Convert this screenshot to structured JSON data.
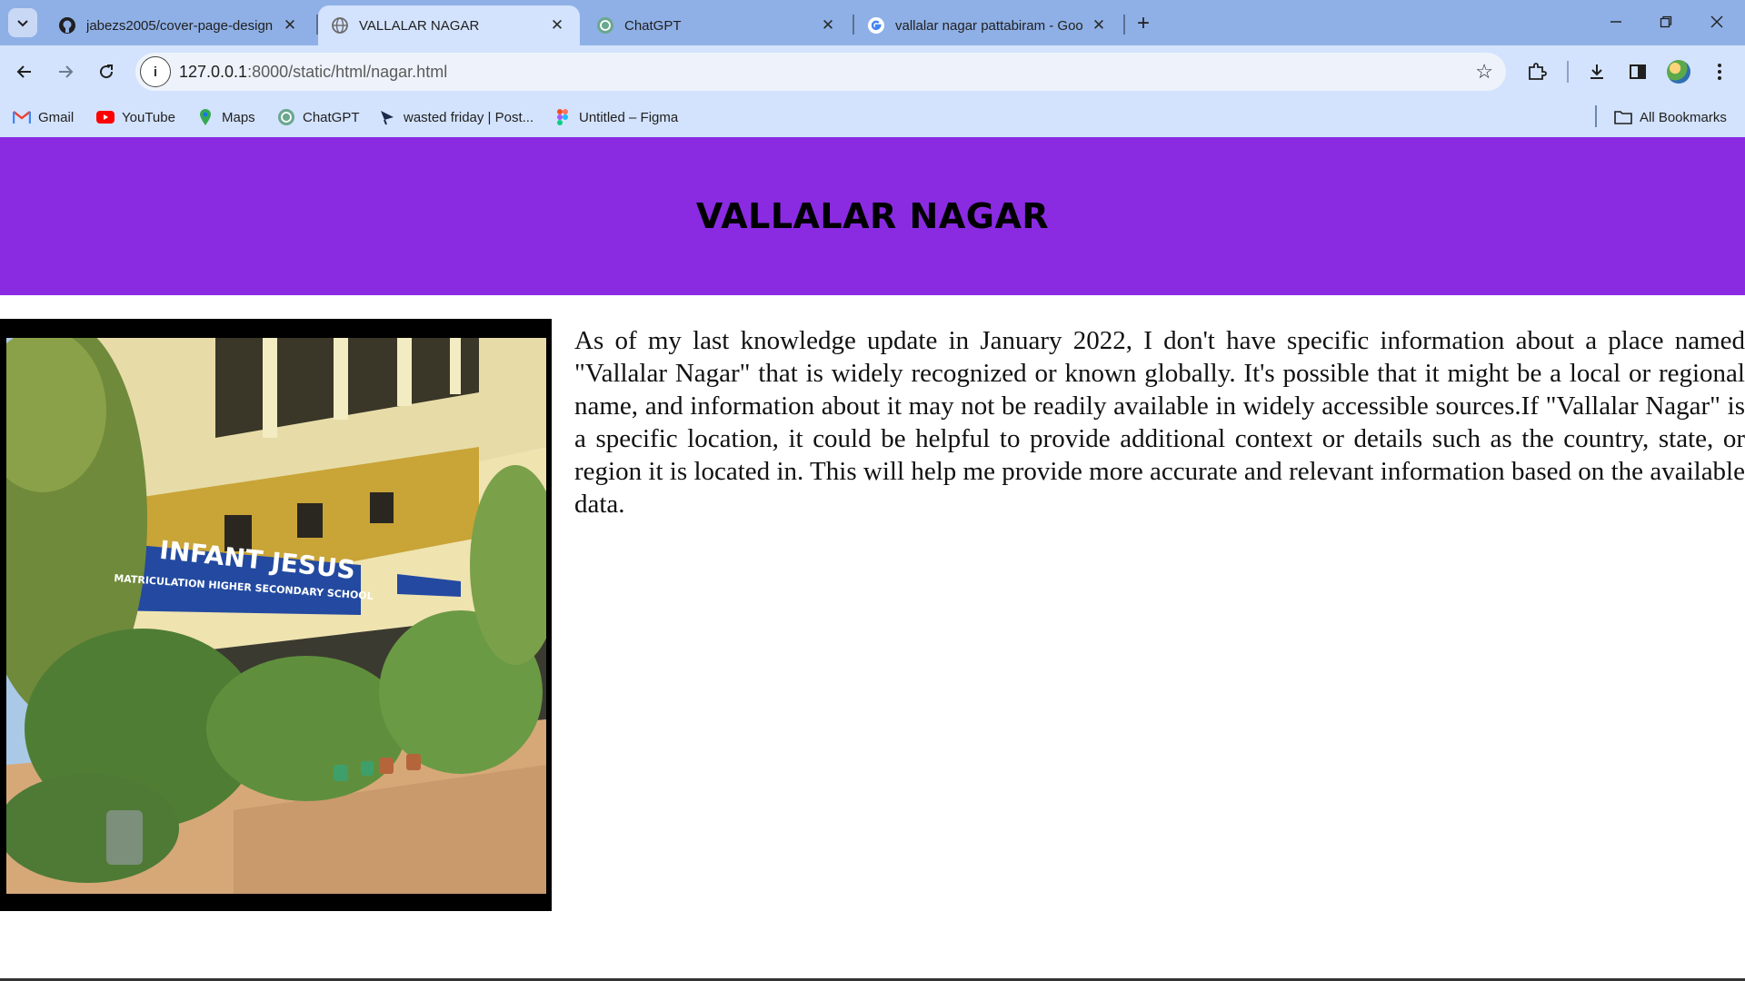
{
  "tabs": [
    {
      "title": "jabezs2005/cover-page-design",
      "icon": "github-icon",
      "active": false
    },
    {
      "title": "VALLALAR NAGAR",
      "icon": "globe-icon",
      "active": true
    },
    {
      "title": "ChatGPT",
      "icon": "chatgpt-icon",
      "active": false
    },
    {
      "title": "vallalar nagar pattabiram - Goo",
      "icon": "google-icon",
      "active": false
    }
  ],
  "address_bar": {
    "host": "127.0.0.1",
    "path": ":8000/static/html/nagar.html"
  },
  "bookmarks": [
    {
      "label": "Gmail",
      "icon": "gmail-icon"
    },
    {
      "label": "YouTube",
      "icon": "youtube-icon"
    },
    {
      "label": "Maps",
      "icon": "maps-icon"
    },
    {
      "label": "ChatGPT",
      "icon": "chatgpt-icon"
    },
    {
      "label": "wasted friday | Post...",
      "icon": "postman-icon"
    },
    {
      "label": "Untitled – Figma",
      "icon": "figma-icon"
    }
  ],
  "all_bookmarks_label": "All Bookmarks",
  "page": {
    "heading": "VALLALAR NAGAR",
    "header_color": "#8a2be2",
    "photo_sign_lines": [
      "INFANT JESUS",
      "MATRICULATION HIGHER SECONDARY SCHOOL"
    ],
    "description": "As of my last knowledge update in January 2022, I don't have specific information about a place named \"Vallalar Nagar\" that is widely recognized or known globally. It's possible that it might be a local or regional name, and information about it may not be readily available in widely accessible sources.If \"Vallalar Nagar\" is a specific location, it could be helpful to provide additional context or details such as the country, state, or region it is located in. This will help me provide more accurate and relevant information based on the available data."
  }
}
